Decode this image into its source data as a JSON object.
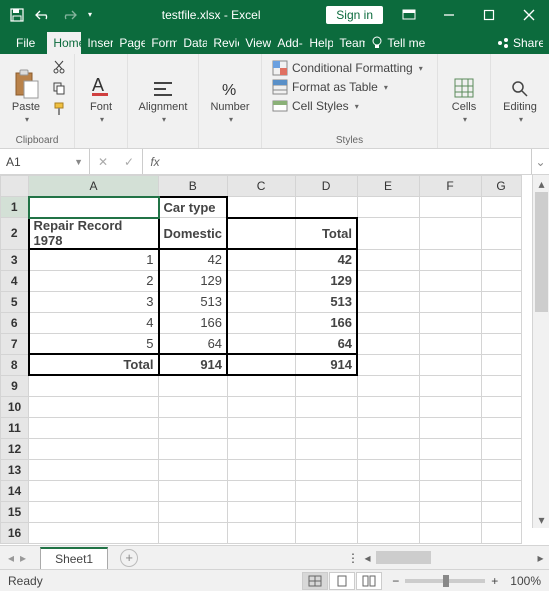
{
  "titlebar": {
    "filename": "testfile.xlsx",
    "appname": "Excel",
    "title_sep": "  -  ",
    "signin": "Sign in"
  },
  "tabs": {
    "file": "File",
    "home": "Home",
    "insert": "Insert",
    "page": "Page",
    "form": "Form",
    "data": "Data",
    "review": "Review",
    "view": "View",
    "addins": "Add-",
    "help": "Help",
    "team": "Team",
    "tellme": "Tell me",
    "share": "Share"
  },
  "ribbon": {
    "clipboard": {
      "paste": "Paste",
      "label": "Clipboard"
    },
    "font": {
      "btn": "Font",
      "label": ""
    },
    "alignment": {
      "btn": "Alignment",
      "label": ""
    },
    "number": {
      "btn": "Number",
      "label": ""
    },
    "styles": {
      "cond": "Conditional Formatting",
      "table": "Format as Table",
      "cell": "Cell Styles",
      "label": "Styles"
    },
    "cells": {
      "btn": "Cells",
      "label": ""
    },
    "editing": {
      "btn": "Editing",
      "label": ""
    }
  },
  "fbar": {
    "name": "A1",
    "fx": "fx",
    "formula": ""
  },
  "columns": [
    "A",
    "B",
    "C",
    "D",
    "E",
    "F",
    "G"
  ],
  "row_numbers": [
    1,
    2,
    3,
    4,
    5,
    6,
    7,
    8,
    9,
    10,
    11,
    12,
    13,
    14,
    15,
    16
  ],
  "cells": {
    "B1": "Car type",
    "A2": "Repair Record 1978",
    "B2": "Domestic",
    "D2": "Total",
    "A3": "1",
    "B3": "42",
    "D3": "42",
    "A4": "2",
    "B4": "129",
    "D4": "129",
    "A5": "3",
    "B5": "513",
    "D5": "513",
    "A6": "4",
    "B6": "166",
    "D6": "166",
    "A7": "5",
    "B7": "64",
    "D7": "64",
    "A8": "Total",
    "B8": "914",
    "D8": "914"
  },
  "sheet_tabs": {
    "sheet1": "Sheet1"
  },
  "status": {
    "ready": "Ready",
    "zoom": "100%",
    "minus": "−",
    "plus": "+"
  }
}
